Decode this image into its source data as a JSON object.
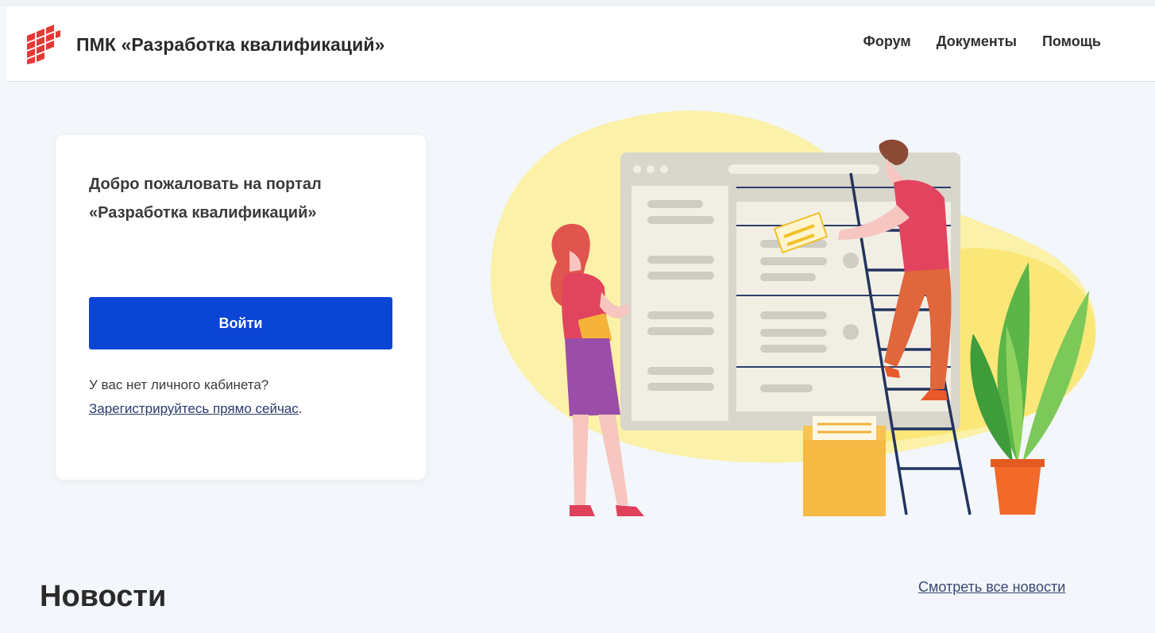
{
  "header": {
    "brand": "ПМК «Разработка квалификаций»",
    "logo_icon": "red-brick-logo-icon",
    "nav": [
      {
        "label": "Форум"
      },
      {
        "label": "Документы"
      },
      {
        "label": "Помощь"
      }
    ]
  },
  "login_card": {
    "welcome_line1": "Добро пожаловать на портал",
    "welcome_line2": "«Разработка квалификаций»",
    "login_button": "Войти",
    "no_account_text": "У вас нет личного кабинета?",
    "register_link": "Зарегистрируйтесь прямо сейчас",
    "register_suffix": "."
  },
  "news": {
    "title": "Новости",
    "all_link": "Смотреть все новости"
  },
  "colors": {
    "accent_blue": "#0b45d6",
    "logo_red": "#e53935",
    "background": "#f3f6fa"
  }
}
